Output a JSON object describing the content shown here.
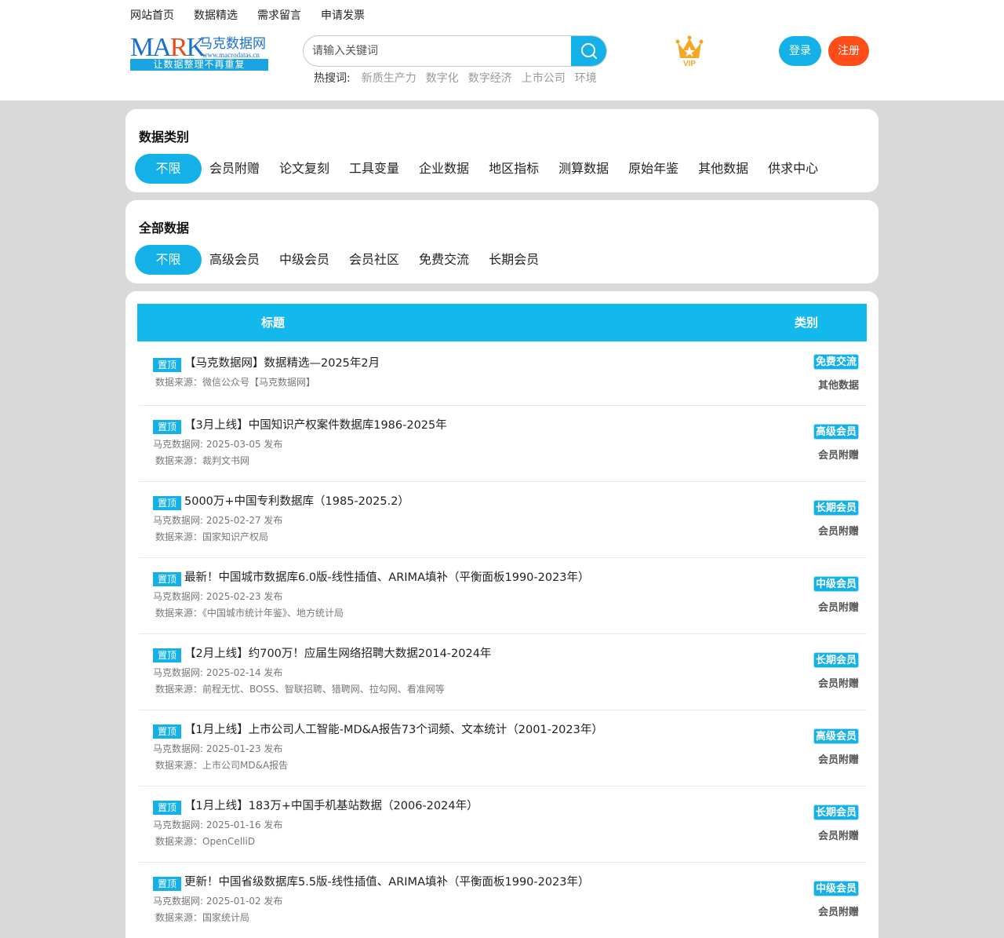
{
  "topnav": [
    "网站首页",
    "数据精选",
    "需求留言",
    "申请发票"
  ],
  "logo": {
    "mark": "MARK",
    "name": "马克数据网",
    "url": "www.macrodatas.cn",
    "slogan": "让数据整理不再重复"
  },
  "search": {
    "placeholder": "请输入关键词"
  },
  "hot": {
    "label": "热搜词:",
    "terms": [
      "新质生产力",
      "数字化",
      "数字经济",
      "上市公司",
      "环境"
    ]
  },
  "vip": {
    "label": "VIP"
  },
  "auth": {
    "login": "登录",
    "register": "注册"
  },
  "category_panel": {
    "title": "数据类别",
    "options": [
      "不限",
      "会员附赠",
      "论文复刻",
      "工具变量",
      "企业数据",
      "地区指标",
      "测算数据",
      "原始年鉴",
      "其他数据",
      "供求中心"
    ],
    "active": 0
  },
  "membership_panel": {
    "title": "全部数据",
    "options": [
      "不限",
      "高级会员",
      "中级会员",
      "会员社区",
      "免费交流",
      "长期会员"
    ],
    "active": 0
  },
  "table": {
    "col_title": "标题",
    "col_category": "类别",
    "pin_label": "置顶",
    "rows": [
      {
        "title": "【马克数据网】数据精选—2025年2月",
        "meta": "",
        "source": "数据来源：微信公众号【马克数据网】",
        "level": "免费交流",
        "category": "其他数据"
      },
      {
        "title": "【3月上线】中国知识产权案件数据库1986-2025年",
        "meta": "马克数据网: 2025-03-05 发布",
        "source": "数据来源：裁判文书网",
        "level": "高级会员",
        "category": "会员附赠"
      },
      {
        "title": "5000万+中国专利数据库（1985-2025.2）",
        "meta": "马克数据网: 2025-02-27 发布",
        "source": "数据来源：国家知识产权局",
        "level": "长期会员",
        "category": "会员附赠"
      },
      {
        "title": "最新！中国城市数据库6.0版-线性插值、ARIMA填补（平衡面板1990-2023年）",
        "meta": "马克数据网: 2025-02-23 发布",
        "source": "数据来源：《中国城市统计年鉴》、地方统计局",
        "level": "中级会员",
        "category": "会员附赠"
      },
      {
        "title": "【2月上线】约700万！应届生网络招聘大数据2014-2024年",
        "meta": "马克数据网: 2025-02-14 发布",
        "source": "数据来源：前程无忧、BOSS、智联招聘、猎聘网、拉勾网、看准网等",
        "level": "长期会员",
        "category": "会员附赠"
      },
      {
        "title": "【1月上线】上市公司人工智能-MD&A报告73个词频、文本统计（2001-2023年）",
        "meta": "马克数据网: 2025-01-23 发布",
        "source": "数据来源：上市公司MD&A报告",
        "level": "高级会员",
        "category": "会员附赠"
      },
      {
        "title": "【1月上线】183万+中国手机基站数据（2006-2024年）",
        "meta": "马克数据网: 2025-01-16 发布",
        "source": "数据来源：OpenCelliD",
        "level": "长期会员",
        "category": "会员附赠"
      },
      {
        "title": "更新！中国省级数据库5.5版-线性插值、ARIMA填补（平衡面板1990-2023年）",
        "meta": "马克数据网: 2025-01-02 发布",
        "source": "数据来源：国家统计局",
        "level": "中级会员",
        "category": "会员附赠"
      }
    ]
  }
}
